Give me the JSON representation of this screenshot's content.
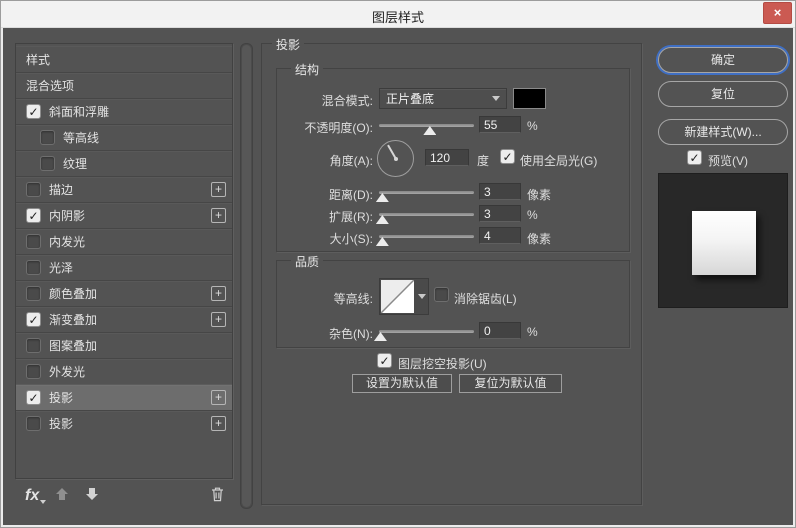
{
  "window": {
    "title": "图层样式"
  },
  "icons": {
    "close": "×",
    "check": "✓",
    "plus": "+",
    "fx": "fx"
  },
  "colors": {
    "dialog_bg": "#535353",
    "titlebar_bg": "#f2f2f2",
    "close_red": "#cb5a52",
    "focus_blue": "#3f6fc4",
    "selected_row": "#6d6d6d",
    "blend_swatch": "#000000",
    "preview_bg": "#282828"
  },
  "sidebar": {
    "items": [
      {
        "label": "样式",
        "checkbox": false,
        "checked": false,
        "indent": false,
        "plus": false,
        "selected": false
      },
      {
        "label": "混合选项",
        "checkbox": false,
        "checked": false,
        "indent": false,
        "plus": false,
        "selected": false
      },
      {
        "label": "斜面和浮雕",
        "checkbox": true,
        "checked": true,
        "indent": false,
        "plus": false,
        "selected": false
      },
      {
        "label": "等高线",
        "checkbox": true,
        "checked": false,
        "indent": true,
        "plus": false,
        "selected": false
      },
      {
        "label": "纹理",
        "checkbox": true,
        "checked": false,
        "indent": true,
        "plus": false,
        "selected": false
      },
      {
        "label": "描边",
        "checkbox": true,
        "checked": false,
        "indent": false,
        "plus": true,
        "selected": false
      },
      {
        "label": "内阴影",
        "checkbox": true,
        "checked": true,
        "indent": false,
        "plus": true,
        "selected": false
      },
      {
        "label": "内发光",
        "checkbox": true,
        "checked": false,
        "indent": false,
        "plus": false,
        "selected": false
      },
      {
        "label": "光泽",
        "checkbox": true,
        "checked": false,
        "indent": false,
        "plus": false,
        "selected": false
      },
      {
        "label": "颜色叠加",
        "checkbox": true,
        "checked": false,
        "indent": false,
        "plus": true,
        "selected": false
      },
      {
        "label": "渐变叠加",
        "checkbox": true,
        "checked": true,
        "indent": false,
        "plus": true,
        "selected": false
      },
      {
        "label": "图案叠加",
        "checkbox": true,
        "checked": false,
        "indent": false,
        "plus": false,
        "selected": false
      },
      {
        "label": "外发光",
        "checkbox": true,
        "checked": false,
        "indent": false,
        "plus": false,
        "selected": false
      },
      {
        "label": "投影",
        "checkbox": true,
        "checked": true,
        "indent": false,
        "plus": true,
        "selected": true
      },
      {
        "label": "投影",
        "checkbox": true,
        "checked": false,
        "indent": false,
        "plus": true,
        "selected": false
      }
    ]
  },
  "panel": {
    "title": "投影",
    "structure": {
      "legend": "结构",
      "blend_mode_label": "混合模式:",
      "blend_mode_value": "正片叠底",
      "opacity_label": "不透明度(O):",
      "opacity_value": "55",
      "opacity_unit": "%",
      "angle_label": "角度(A):",
      "angle_value": "120",
      "angle_unit": "度",
      "global_light_label": "使用全局光(G)",
      "distance_label": "距离(D):",
      "distance_value": "3",
      "distance_unit": "像素",
      "spread_label": "扩展(R):",
      "spread_value": "3",
      "spread_unit": "%",
      "size_label": "大小(S):",
      "size_value": "4",
      "size_unit": "像素"
    },
    "quality": {
      "legend": "品质",
      "contour_label": "等高线:",
      "antialias_label": "消除锯齿(L)",
      "noise_label": "杂色(N):",
      "noise_value": "0",
      "noise_unit": "%"
    },
    "knockout_label": "图层挖空投影(U)",
    "make_default_label": "设置为默认值",
    "reset_default_label": "复位为默认值"
  },
  "actions": {
    "ok_label": "确定",
    "reset_label": "复位",
    "new_style_label": "新建样式(W)...",
    "preview_label": "预览(V)"
  },
  "sliders": {
    "opacity_pct": 53,
    "distance_pct": 3,
    "spread_pct": 3,
    "size_pct": 3,
    "noise_pct": 1
  },
  "angle_degrees": 120
}
